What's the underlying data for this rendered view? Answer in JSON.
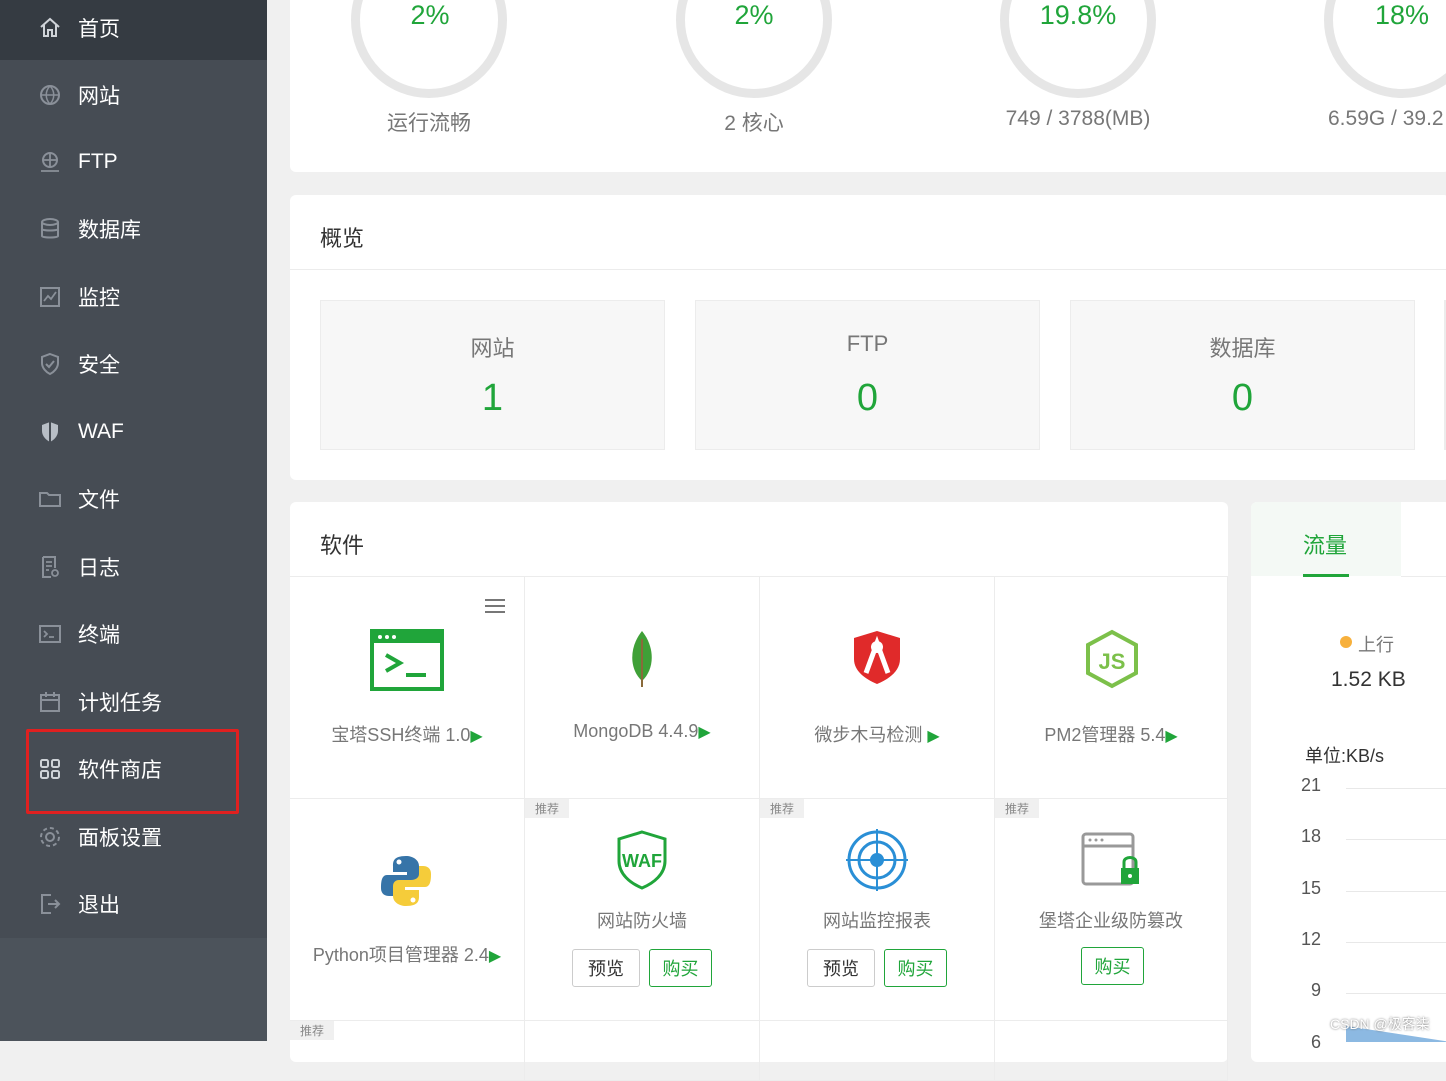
{
  "sidebar": {
    "items": [
      {
        "label": "首页",
        "icon": "home-icon"
      },
      {
        "label": "网站",
        "icon": "globe-icon"
      },
      {
        "label": "FTP",
        "icon": "ftp-icon"
      },
      {
        "label": "数据库",
        "icon": "database-icon"
      },
      {
        "label": "监控",
        "icon": "monitor-icon"
      },
      {
        "label": "安全",
        "icon": "shield-icon"
      },
      {
        "label": "WAF",
        "icon": "waf-shield-icon"
      },
      {
        "label": "文件",
        "icon": "folder-icon"
      },
      {
        "label": "日志",
        "icon": "log-icon"
      },
      {
        "label": "终端",
        "icon": "terminal-icon"
      },
      {
        "label": "计划任务",
        "icon": "calendar-icon"
      },
      {
        "label": "软件商店",
        "icon": "grid-icon"
      },
      {
        "label": "面板设置",
        "icon": "gear-icon"
      },
      {
        "label": "退出",
        "icon": "logout-icon"
      }
    ],
    "active_index": 0,
    "highlighted_index": 11,
    "highlight_color": "#e02020"
  },
  "status": {
    "gauges": [
      {
        "value": "2%",
        "label": "运行流畅"
      },
      {
        "value": "2%",
        "label": "2 核心"
      },
      {
        "value": "19.8%",
        "label": "749 / 3788(MB)"
      },
      {
        "value": "18%",
        "label": "6.59G / 39.2"
      }
    ]
  },
  "overview": {
    "title": "概览",
    "stats": [
      {
        "name": "网站",
        "value": "1"
      },
      {
        "name": "FTP",
        "value": "0"
      },
      {
        "name": "数据库",
        "value": "0"
      }
    ]
  },
  "software": {
    "title": "软件",
    "items": [
      {
        "name": "宝塔SSH终端 1.0",
        "arrow": "▶",
        "icon": "terminal-app-icon"
      },
      {
        "name": "MongoDB 4.4.9",
        "arrow": "▶",
        "icon": "mongodb-leaf-icon"
      },
      {
        "name": "微步木马检测 ",
        "arrow": "▶",
        "icon": "trojan-detect-icon"
      },
      {
        "name": "PM2管理器 5.4",
        "arrow": "▶",
        "icon": "nodejs-icon"
      },
      {
        "name": "Python项目管理器 2.4",
        "arrow": "▶",
        "icon": "python-icon"
      },
      {
        "name": "网站防火墙",
        "tag": "推荐",
        "icon": "waf-icon",
        "preview": "预览",
        "buy": "购买"
      },
      {
        "name": "网站监控报表",
        "tag": "推荐",
        "icon": "site-monitor-icon",
        "preview": "预览",
        "buy": "购买"
      },
      {
        "name": "堡塔企业级防篡改",
        "tag": "推荐",
        "icon": "tamper-proof-icon",
        "buy": "购买"
      }
    ],
    "bottom_tag": "推荐"
  },
  "traffic": {
    "tab": "流量",
    "upload_label": "上行",
    "upload_value": "1.52 KB",
    "unit": "单位:KB/s",
    "yticks": [
      "21",
      "18",
      "15",
      "12",
      "9",
      "6"
    ],
    "upload_color": "#f7b03c",
    "accent": "#20a53a"
  },
  "watermark": "CSDN @极客柒"
}
